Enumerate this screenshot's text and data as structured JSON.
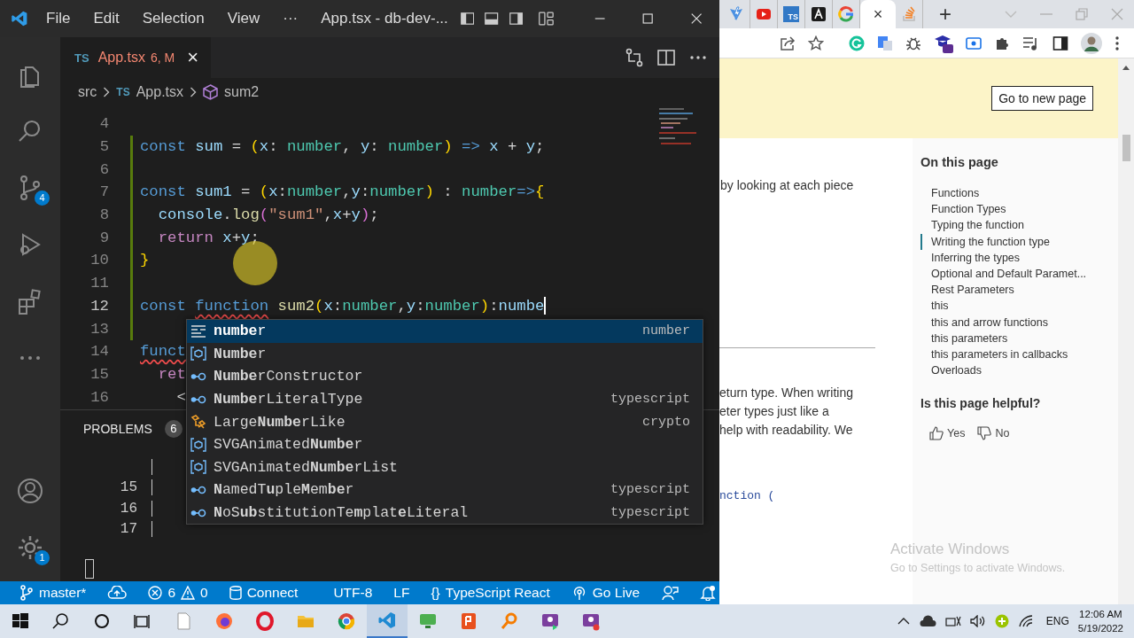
{
  "titlebar": {
    "menu": [
      {
        "label": "File"
      },
      {
        "label": "Edit"
      },
      {
        "label": "Selection"
      },
      {
        "label": "View"
      }
    ],
    "overflow": "···",
    "title": "App.tsx - db-dev-..."
  },
  "activity_bar": {
    "top": [
      {
        "kind": "files"
      },
      {
        "kind": "search"
      },
      {
        "kind": "source_control",
        "badge": "4"
      },
      {
        "kind": "run_debug"
      },
      {
        "kind": "extensions"
      },
      {
        "kind": "more"
      }
    ],
    "bottom": [
      {
        "kind": "account"
      },
      {
        "kind": "settings",
        "badge": "1"
      }
    ]
  },
  "editor_tab": {
    "lang": "TS",
    "name": "App.tsx",
    "status": "6, M",
    "close": "×"
  },
  "breadcrumb": [
    {
      "kind": "folder",
      "label": "src"
    },
    {
      "kind": "file",
      "badge": "TS",
      "label": "App.tsx"
    },
    {
      "kind": "symbol",
      "label": "sum2"
    }
  ],
  "code_lines": [
    {
      "number": "4",
      "modified": false,
      "current": false
    },
    {
      "number": "5",
      "modified": true,
      "current": false,
      "tokens": [
        {
          "text": "const ",
          "kind": "kw"
        },
        {
          "text": "sum",
          "kind": "var"
        },
        {
          "text": " = ",
          "kind": "punc"
        },
        {
          "text": "(",
          "kind": "paren"
        },
        {
          "text": "x",
          "kind": "var"
        },
        {
          "text": ": ",
          "kind": "punc"
        },
        {
          "text": "number",
          "kind": "type"
        },
        {
          "text": ", ",
          "kind": "punc"
        },
        {
          "text": "y",
          "kind": "var"
        },
        {
          "text": ": ",
          "kind": "punc"
        },
        {
          "text": "number",
          "kind": "type"
        },
        {
          "text": ")",
          "kind": "paren"
        },
        {
          "text": " => ",
          "kind": "kw"
        },
        {
          "text": "x",
          "kind": "var"
        },
        {
          "text": " + ",
          "kind": "punc"
        },
        {
          "text": "y",
          "kind": "var"
        },
        {
          "text": ";",
          "kind": "punc"
        }
      ]
    },
    {
      "number": "6",
      "modified": true,
      "current": false
    },
    {
      "number": "7",
      "modified": true,
      "current": false,
      "tokens": [
        {
          "text": "const ",
          "kind": "kw"
        },
        {
          "text": "sum1",
          "kind": "var"
        },
        {
          "text": " = ",
          "kind": "punc"
        },
        {
          "text": "(",
          "kind": "paren"
        },
        {
          "text": "x",
          "kind": "var"
        },
        {
          "text": ":",
          "kind": "punc"
        },
        {
          "text": "number",
          "kind": "type"
        },
        {
          "text": ",",
          "kind": "punc"
        },
        {
          "text": "y",
          "kind": "var"
        },
        {
          "text": ":",
          "kind": "punc"
        },
        {
          "text": "number",
          "kind": "type"
        },
        {
          "text": ")",
          "kind": "paren"
        },
        {
          "text": " : ",
          "kind": "punc"
        },
        {
          "text": "number",
          "kind": "type"
        },
        {
          "text": "=>",
          "kind": "kw"
        },
        {
          "text": "{",
          "kind": "paren"
        }
      ]
    },
    {
      "number": "8",
      "modified": true,
      "current": false,
      "tokens": [
        {
          "text": "  console",
          "kind": "var"
        },
        {
          "text": ".",
          "kind": "punc"
        },
        {
          "text": "log",
          "kind": "fn"
        },
        {
          "text": "(",
          "kind": "paren2"
        },
        {
          "text": "\"sum1\"",
          "kind": "str"
        },
        {
          "text": ",",
          "kind": "punc"
        },
        {
          "text": "x",
          "kind": "var"
        },
        {
          "text": "+",
          "kind": "punc"
        },
        {
          "text": "y",
          "kind": "var"
        },
        {
          "text": ")",
          "kind": "paren2"
        },
        {
          "text": ";",
          "kind": "punc"
        }
      ]
    },
    {
      "number": "9",
      "modified": true,
      "current": false,
      "tokens": [
        {
          "text": "  return ",
          "kind": "ctrl"
        },
        {
          "text": "x",
          "kind": "var"
        },
        {
          "text": "+",
          "kind": "punc"
        },
        {
          "text": "y",
          "kind": "var"
        },
        {
          "text": ";",
          "kind": "punc"
        }
      ]
    },
    {
      "number": "10",
      "modified": true,
      "current": false,
      "tokens": [
        {
          "text": "}",
          "kind": "paren"
        }
      ]
    },
    {
      "number": "11",
      "modified": true,
      "current": false
    },
    {
      "number": "12",
      "modified": true,
      "current": true,
      "tokens": [
        {
          "text": "const ",
          "kind": "kw"
        },
        {
          "text": "function",
          "kind": "kw_error"
        },
        {
          "text": " sum2",
          "kind": "fn"
        },
        {
          "text": "(",
          "kind": "paren"
        },
        {
          "text": "x",
          "kind": "var"
        },
        {
          "text": ":",
          "kind": "punc"
        },
        {
          "text": "number",
          "kind": "type"
        },
        {
          "text": ",",
          "kind": "punc"
        },
        {
          "text": "y",
          "kind": "var"
        },
        {
          "text": ":",
          "kind": "punc"
        },
        {
          "text": "number",
          "kind": "type"
        },
        {
          "text": ")",
          "kind": "paren"
        },
        {
          "text": ":",
          "kind": "punc"
        },
        {
          "text": "numbe",
          "kind": "var"
        }
      ]
    },
    {
      "number": "13",
      "modified": true,
      "current": false
    },
    {
      "number": "14",
      "modified": false,
      "current": false,
      "tokens": [
        {
          "text": "funct",
          "kind": "kw_error"
        }
      ]
    },
    {
      "number": "15",
      "modified": false,
      "current": false,
      "tokens": [
        {
          "text": "  ret",
          "kind": "ctrl"
        }
      ]
    },
    {
      "number": "16",
      "modified": false,
      "current": false,
      "tokens": [
        {
          "text": "    <",
          "kind": "punc"
        }
      ]
    }
  ],
  "suggestions": [
    {
      "label": "**numbe**r",
      "detail": "number",
      "kind": "keyword",
      "selected": true
    },
    {
      "label": "**Numbe**r",
      "kind": "variable",
      "selected": false
    },
    {
      "label": "**Numbe**rConstructor",
      "kind": "interface",
      "selected": false
    },
    {
      "label": "**Numbe**rLiteralType",
      "detail": "typescript",
      "kind": "interface",
      "selected": false
    },
    {
      "label": "Large**Numbe**rLike",
      "detail": "crypto",
      "kind": "class",
      "selected": false
    },
    {
      "label": "SVGAnimated**Numbe**r",
      "kind": "variable",
      "selected": false
    },
    {
      "label": "SVGAnimated**Numbe**rList",
      "kind": "variable",
      "selected": false
    },
    {
      "label": "**N**amedT**u**ple**M**em**be**r",
      "detail": "typescript",
      "kind": "interface",
      "selected": false
    },
    {
      "label": "**N**oS**ub**stitutionTe**m**plat**e**Literal",
      "detail": "typescript",
      "kind": "interface",
      "selected": false
    }
  ],
  "panel": {
    "title": "PROBLEMS",
    "count": "6",
    "lines": [
      {
        "number": "15"
      },
      {
        "number": "16"
      },
      {
        "number": "17"
      }
    ]
  },
  "status_bar": {
    "branch": "master*",
    "errors": "6",
    "warnings": "0",
    "connect": "Connect",
    "encoding": "UTF-8",
    "eol": "LF",
    "language_icon": "{}",
    "language": "TypeScript React",
    "live": "Go Live"
  },
  "browser": {
    "tabs": [
      {
        "kind": "vite",
        "selected": false
      },
      {
        "kind": "video",
        "selected": false
      },
      {
        "kind": "ts",
        "label": "TS",
        "selected": false
      },
      {
        "kind": "dark_a",
        "selected": false
      },
      {
        "kind": "google",
        "selected": false
      },
      {
        "kind": "blank",
        "close": "×",
        "selected": true
      },
      {
        "kind": "stack",
        "selected": false
      }
    ],
    "new_tab": "+",
    "banner_button": "Go to new page",
    "intro": "by looking at each piece",
    "paragraph": [
      "eturn type. When writing",
      "eter types just like a",
      "help with readability. We"
    ],
    "code": "nction (",
    "toc": {
      "title": "On this page",
      "items": [
        {
          "label": "Functions",
          "selected": false
        },
        {
          "label": "Function Types",
          "selected": false
        },
        {
          "label": "Typing the function",
          "selected": false
        },
        {
          "label": "Writing the function type",
          "selected": true
        },
        {
          "label": "Inferring the types",
          "selected": false
        },
        {
          "label": "Optional and Default Paramet...",
          "selected": false
        },
        {
          "label": "Rest Parameters",
          "selected": false
        },
        {
          "label": "this",
          "selected": false
        },
        {
          "label": "this and arrow functions",
          "selected": false
        },
        {
          "label": "this parameters",
          "selected": false
        },
        {
          "label": "this parameters in callbacks",
          "selected": false
        },
        {
          "label": "Overloads",
          "selected": false
        }
      ]
    },
    "feedback": {
      "question": "Is this page helpful?",
      "yes": "Yes",
      "no": "No"
    }
  },
  "os_notice": {
    "title": "Activate Windows",
    "subtitle": "Go to Settings to activate Windows."
  },
  "taskbar": {
    "apps": [
      {
        "kind": "start",
        "selected": false
      },
      {
        "kind": "search",
        "selected": false
      },
      {
        "kind": "cortana",
        "selected": false
      },
      {
        "kind": "taskview",
        "selected": false
      },
      {
        "kind": "notepad",
        "selected": false
      },
      {
        "kind": "firefox",
        "selected": false
      },
      {
        "kind": "opera",
        "selected": false
      },
      {
        "kind": "folder",
        "selected": false
      },
      {
        "kind": "chrome",
        "selected": false
      },
      {
        "kind": "vscode",
        "selected": true
      },
      {
        "kind": "monitor",
        "selected": false
      },
      {
        "kind": "page",
        "selected": false
      },
      {
        "kind": "magnifier",
        "selected": false
      },
      {
        "kind": "chat",
        "selected": false
      },
      {
        "kind": "chat2",
        "selected": false
      }
    ],
    "language": "ENG",
    "time": "12:06 AM",
    "date": "5/19/2022"
  }
}
